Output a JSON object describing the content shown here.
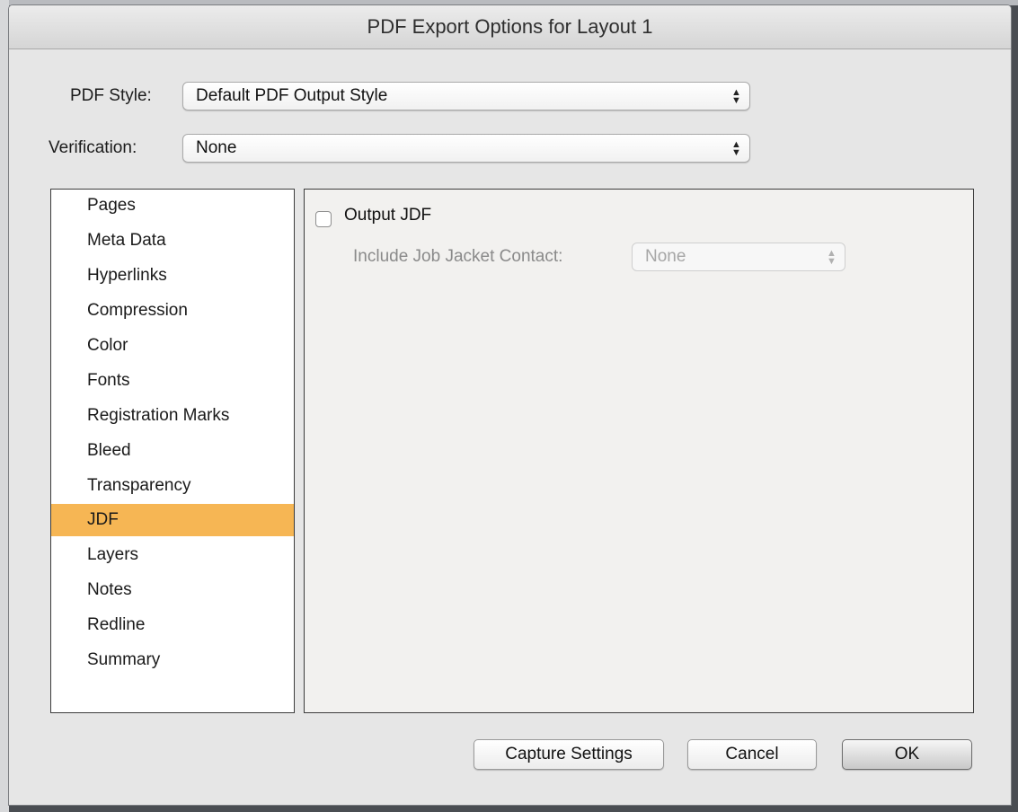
{
  "dialog": {
    "title": "PDF Export Options for Layout 1"
  },
  "pdf_style": {
    "label": "PDF Style:",
    "value": "Default PDF Output Style"
  },
  "verification": {
    "label": "Verification:",
    "value": "None"
  },
  "categories": [
    {
      "label": "Pages"
    },
    {
      "label": "Meta Data"
    },
    {
      "label": "Hyperlinks"
    },
    {
      "label": "Compression"
    },
    {
      "label": "Color"
    },
    {
      "label": "Fonts"
    },
    {
      "label": "Registration Marks"
    },
    {
      "label": "Bleed"
    },
    {
      "label": "Transparency"
    },
    {
      "label": "JDF"
    },
    {
      "label": "Layers"
    },
    {
      "label": "Notes"
    },
    {
      "label": "Redline"
    },
    {
      "label": "Summary"
    }
  ],
  "selected_category": "JDF",
  "jdf_panel": {
    "output_jdf_label": "Output JDF",
    "output_jdf_checked": false,
    "contact_label": "Include Job Jacket Contact:",
    "contact_value": "None"
  },
  "buttons": {
    "capture_settings": "Capture Settings",
    "cancel": "Cancel",
    "ok": "OK"
  },
  "colors": {
    "selection": "#f6b654"
  }
}
